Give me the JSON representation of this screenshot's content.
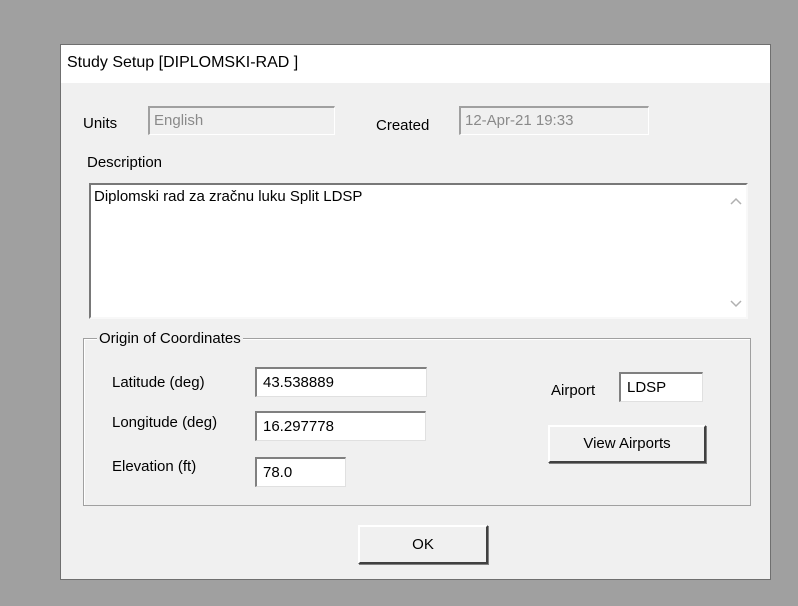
{
  "dialog": {
    "title": "Study Setup [DIPLOMSKI-RAD ]"
  },
  "units": {
    "label": "Units",
    "value": "English"
  },
  "created": {
    "label": "Created",
    "value": "12-Apr-21 19:33"
  },
  "description": {
    "label": "Description",
    "text": "Diplomski rad za zračnu luku Split LDSP"
  },
  "origin": {
    "group_label": "Origin of Coordinates",
    "latitude_label": "Latitude (deg)",
    "latitude_value": "43.538889",
    "longitude_label": "Longitude (deg)",
    "longitude_value": "16.297778",
    "elevation_label": "Elevation (ft)",
    "elevation_value": "78.0",
    "airport_label": "Airport",
    "airport_value": "LDSP",
    "view_airports_label": "View Airports"
  },
  "buttons": {
    "ok_label": "OK"
  },
  "icons": {
    "scroll_up": "chevron-up-icon",
    "scroll_down": "chevron-down-icon"
  }
}
